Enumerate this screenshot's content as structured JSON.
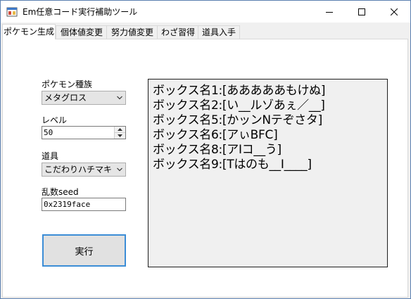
{
  "window": {
    "title": "Em任意コード実行補助ツール"
  },
  "tabs": [
    {
      "label": "ポケモン生成"
    },
    {
      "label": "個体値変更"
    },
    {
      "label": "努力値変更"
    },
    {
      "label": "わざ習得"
    },
    {
      "label": "道具入手"
    }
  ],
  "form": {
    "species_label": "ポケモン種族",
    "species_value": "メタグロス",
    "level_label": "レベル",
    "level_value": "50",
    "item_label": "道具",
    "item_value": "こだわりハチマキ",
    "seed_label": "乱数seed",
    "seed_value": "0x2319face",
    "execute_label": "実行"
  },
  "output": {
    "lines": [
      "ボックス名1:[あああああもけぬ]",
      "ボックス名2:[い__ルゾあぇ／__]",
      "ボックス名5:[かッンNテぞさタ]",
      "ボックス名6:[アぃBFC]",
      "ボックス名8:[アIコ__う]",
      "ボックス名9:[Tはのも__I____]"
    ]
  }
}
